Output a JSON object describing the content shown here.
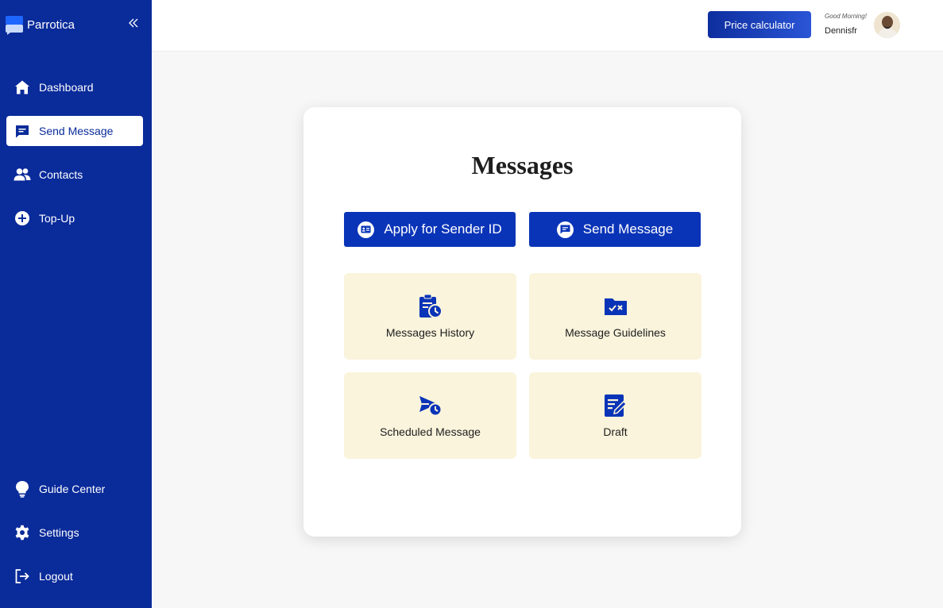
{
  "brand": {
    "name": "Parrotica"
  },
  "sidebar": {
    "items": [
      {
        "label": "Dashboard",
        "icon": "home-icon"
      },
      {
        "label": "Send Message",
        "icon": "message-icon",
        "active": true
      },
      {
        "label": "Contacts",
        "icon": "contacts-icon"
      },
      {
        "label": "Top-Up",
        "icon": "plus-circle-icon"
      }
    ],
    "bottom_items": [
      {
        "label": "Guide Center",
        "icon": "lightbulb-icon"
      },
      {
        "label": "Settings",
        "icon": "gear-icon"
      },
      {
        "label": "Logout",
        "icon": "logout-icon"
      }
    ]
  },
  "header": {
    "price_calculator_label": "Price calculator",
    "greeting": "Good Morning!",
    "username": "Dennisfr"
  },
  "main": {
    "title": "Messages",
    "actions": [
      {
        "label": "Apply for Sender ID",
        "icon": "id-card-icon"
      },
      {
        "label": "Send Message",
        "icon": "message-icon"
      }
    ],
    "tiles": [
      {
        "label": "Messages History",
        "icon": "clipboard-clock-icon"
      },
      {
        "label": "Message Guidelines",
        "icon": "folder-check-icon"
      },
      {
        "label": "Scheduled Message",
        "icon": "send-clock-icon"
      },
      {
        "label": "Draft",
        "icon": "edit-note-icon"
      }
    ]
  },
  "colors": {
    "sidebar": "#0a2b9a",
    "primary_button": "#0a34b8",
    "tile_background": "#faf4dc"
  }
}
